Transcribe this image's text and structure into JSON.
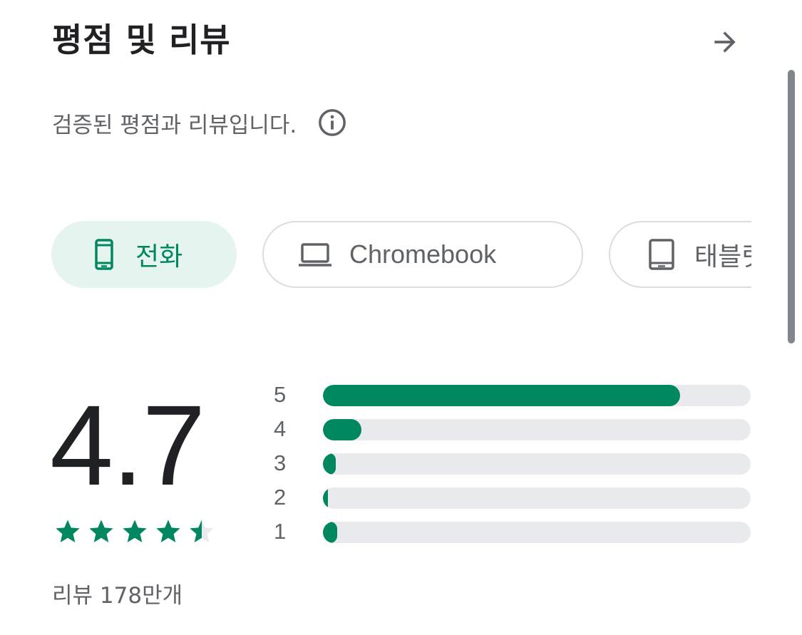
{
  "header": {
    "title": "평점 및 리뷰",
    "arrow_icon": "arrow-right-icon"
  },
  "subtitle": {
    "text": "검증된 평점과 리뷰입니다.",
    "info_icon": "info-icon"
  },
  "device_tabs": [
    {
      "label": "전화",
      "icon": "phone-icon",
      "selected": true
    },
    {
      "label": "Chromebook",
      "icon": "laptop-icon",
      "selected": false
    },
    {
      "label": "태블릿",
      "icon": "tablet-icon",
      "selected": false
    }
  ],
  "rating": {
    "score": "4.7",
    "stars_filled": 4.7,
    "stars_max": 5,
    "review_count": "리뷰 178만개"
  },
  "distribution": [
    {
      "label": "5",
      "fraction": 0.835
    },
    {
      "label": "4",
      "fraction": 0.09
    },
    {
      "label": "3",
      "fraction": 0.03
    },
    {
      "label": "2",
      "fraction": 0.012
    },
    {
      "label": "1",
      "fraction": 0.033
    }
  ],
  "colors": {
    "accent": "#01875f",
    "selected_chip_bg": "#e6f4ef",
    "track": "#e8eaed",
    "text_primary": "#202124",
    "text_secondary": "#5f6368"
  }
}
